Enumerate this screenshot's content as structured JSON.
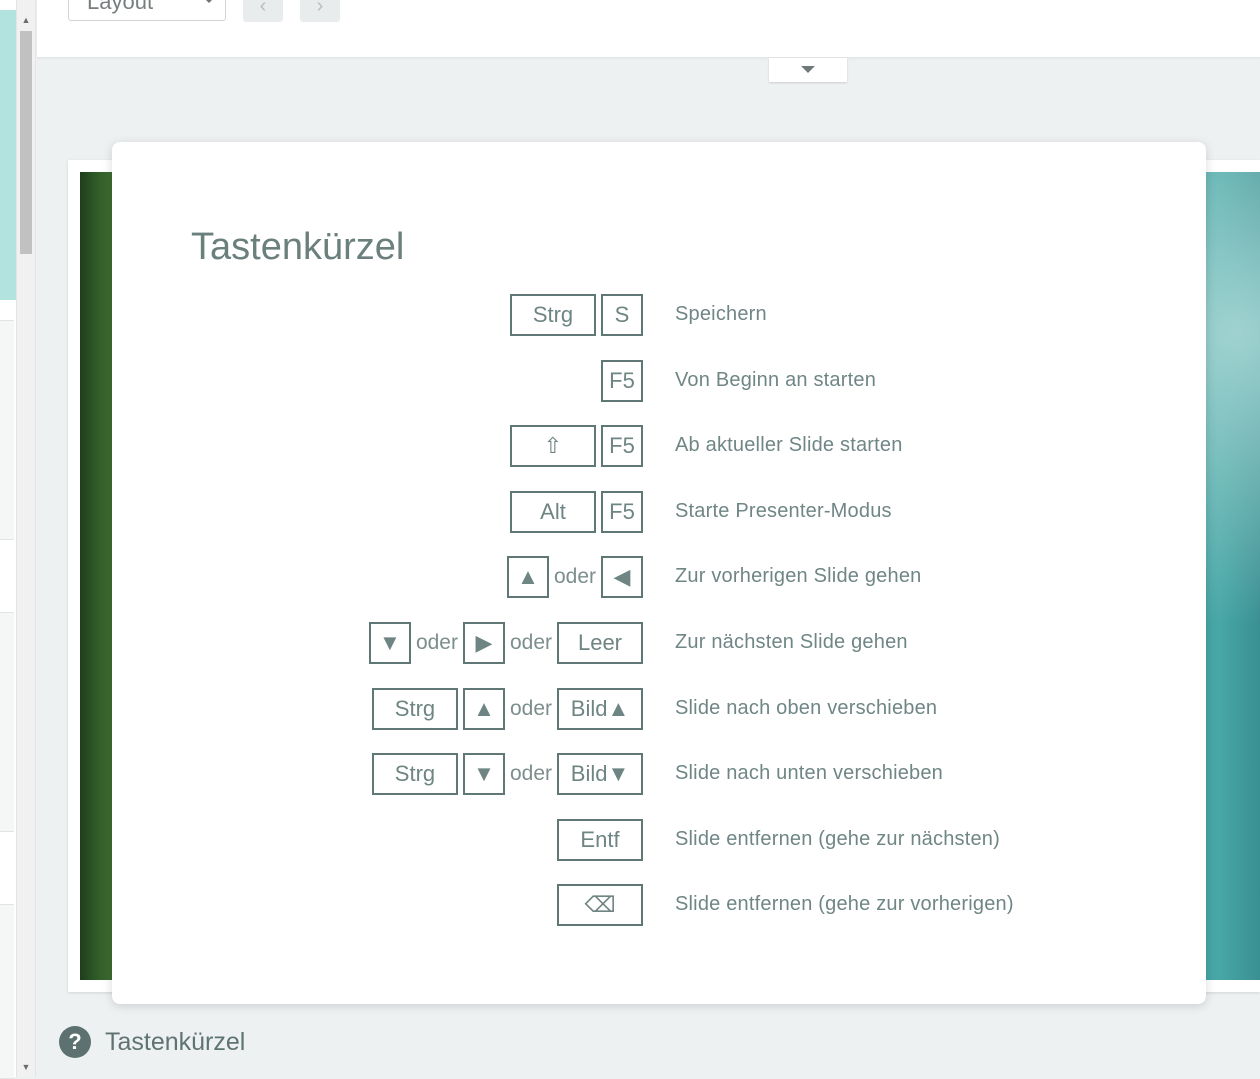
{
  "toolbar": {
    "layout_select_value": "Layout",
    "prev_label": "‹",
    "next_label": "›"
  },
  "modal": {
    "title": "Tastenkürzel",
    "or_label": "oder",
    "shortcuts": [
      {
        "keys": [
          "Strg",
          "S"
        ],
        "description": "Speichern"
      },
      {
        "keys": [
          "F5"
        ],
        "description": "Von Beginn an starten"
      },
      {
        "keys": [
          "⇧",
          "F5"
        ],
        "description": "Ab aktueller Slide starten"
      },
      {
        "keys": [
          "Alt",
          "F5"
        ],
        "description": "Starte Presenter-Modus"
      },
      {
        "keys": [
          "▲",
          "oder",
          "◀"
        ],
        "description": "Zur vorherigen Slide gehen"
      },
      {
        "keys": [
          "▼",
          "oder",
          "▶",
          "oder",
          "Leer"
        ],
        "description": "Zur nächsten Slide gehen"
      },
      {
        "keys": [
          "Strg",
          "▲",
          "oder",
          "Bild▲"
        ],
        "description": "Slide nach oben verschieben"
      },
      {
        "keys": [
          "Strg",
          "▼",
          "oder",
          "Bild▼"
        ],
        "description": "Slide nach unten verschieben"
      },
      {
        "keys": [
          "Entf"
        ],
        "description": "Slide entfernen (gehe zur nächsten)"
      },
      {
        "keys": [
          "⌫"
        ],
        "description": "Slide entfernen (gehe zur vorherigen)"
      }
    ]
  },
  "footer": {
    "help_icon_glyph": "?",
    "label": "Tastenkürzel"
  },
  "colors": {
    "key_border": "#5f7876",
    "text": "#6f8685",
    "background": "#eef1f2"
  }
}
